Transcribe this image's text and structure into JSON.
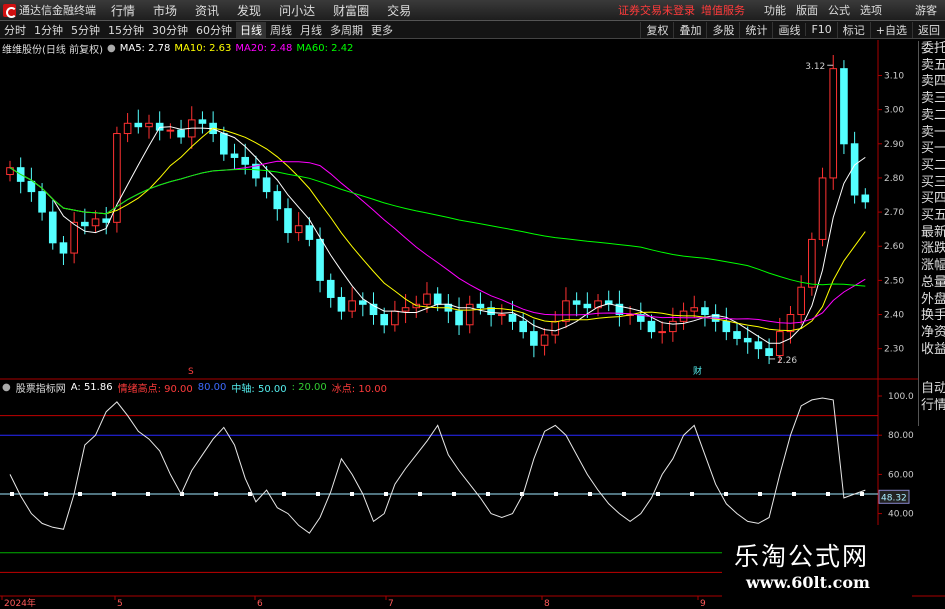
{
  "menubar": {
    "app_title": "通达信金融终端",
    "items": [
      "行情",
      "市场",
      "资讯",
      "发现",
      "问小达",
      "财富圈",
      "交易"
    ],
    "notice": "证券交易未登录",
    "notice_sub": "增值服务",
    "right_items": [
      "功能",
      "版面",
      "公式",
      "选项"
    ],
    "guest": "游客"
  },
  "toolbar": {
    "periods": [
      "分时",
      "1分钟",
      "5分钟",
      "15分钟",
      "30分钟",
      "60分钟",
      "日线",
      "周线",
      "月线",
      "多周期",
      "更多"
    ],
    "active_period": "日线",
    "right_buttons": [
      "复权",
      "叠加",
      "多股",
      "统计",
      "画线",
      "F10",
      "标记",
      "+自选",
      "返回"
    ]
  },
  "main_chart": {
    "title": "维维股份(日线 前复权)",
    "ma_labels": [
      {
        "text": "MA5: 2.78",
        "color": "#ffffff"
      },
      {
        "text": "MA10: 2.63",
        "color": "#ffff00"
      },
      {
        "text": "MA20: 2.48",
        "color": "#ff00ff"
      },
      {
        "text": "MA60: 2.42",
        "color": "#00ff00"
      }
    ],
    "price_ticks": [
      "3.10",
      "3.00",
      "2.90",
      "2.80",
      "2.70",
      "2.60",
      "2.50",
      "2.40",
      "2.30"
    ],
    "high_label": "3.12",
    "low_label": "2.26",
    "event_markers": [
      "S",
      "财"
    ]
  },
  "indicator": {
    "title": "股票指标网",
    "a_value": "A: 51.86",
    "sell_label": "情绪高点: 90.00",
    "blue_label": "80.00",
    "mid_label": "中轴: 50.00",
    "low1_label": ": 20.00",
    "low2_label": "冰点: 10.00",
    "ticks": [
      "100.0",
      "80.00",
      "60.00",
      "40.00"
    ],
    "current_value": "48.32"
  },
  "date_axis": [
    "2024年",
    "5",
    "6",
    "7",
    "8",
    "9"
  ],
  "right_panel": [
    "委托",
    "卖五",
    "卖四",
    "卖三",
    "卖二",
    "卖一",
    "买一",
    "买二",
    "买三",
    "买四",
    "买五",
    "最新",
    "涨跌",
    "涨幅",
    "总量",
    "外盘",
    "换手",
    "净资",
    "收益"
  ],
  "right_panel2": [
    "自动",
    "行情"
  ],
  "watermark": {
    "line1": "乐淘公式网",
    "line2": "www.60lt.com"
  },
  "chart_data": {
    "type": "candlestick",
    "price_range": [
      2.22,
      3.16
    ],
    "ohlc_close_approx": [
      2.83,
      2.79,
      2.76,
      2.7,
      2.61,
      2.58,
      2.67,
      2.66,
      2.68,
      2.67,
      2.93,
      2.96,
      2.95,
      2.96,
      2.94,
      2.94,
      2.92,
      2.97,
      2.96,
      2.93,
      2.87,
      2.86,
      2.84,
      2.8,
      2.76,
      2.71,
      2.64,
      2.66,
      2.62,
      2.5,
      2.45,
      2.41,
      2.44,
      2.43,
      2.4,
      2.37,
      2.41,
      2.42,
      2.43,
      2.46,
      2.43,
      2.41,
      2.37,
      2.43,
      2.42,
      2.4,
      2.4,
      2.38,
      2.35,
      2.31,
      2.34,
      2.38,
      2.44,
      2.43,
      2.42,
      2.44,
      2.43,
      2.4,
      2.4,
      2.38,
      2.35,
      2.35,
      2.38,
      2.41,
      2.42,
      2.4,
      2.38,
      2.35,
      2.33,
      2.32,
      2.3,
      2.28,
      2.35,
      2.4,
      2.48,
      2.62,
      2.8,
      3.12,
      2.9,
      2.75,
      2.73
    ],
    "indicator_values": [
      60,
      49,
      40,
      35,
      33,
      32,
      50,
      75,
      80,
      92,
      97,
      90,
      82,
      78,
      72,
      60,
      50,
      62,
      70,
      78,
      84,
      75,
      58,
      46,
      52,
      43,
      40,
      34,
      30,
      38,
      51,
      68,
      60,
      50,
      36,
      40,
      55,
      63,
      70,
      77,
      85,
      70,
      62,
      55,
      48,
      40,
      38,
      40,
      50,
      68,
      82,
      85,
      80,
      70,
      60,
      52,
      45,
      40,
      36,
      40,
      48,
      60,
      68,
      80,
      85,
      70,
      55,
      45,
      40,
      36,
      35,
      38,
      60,
      80,
      95,
      98,
      99,
      98,
      48,
      50,
      52
    ]
  }
}
